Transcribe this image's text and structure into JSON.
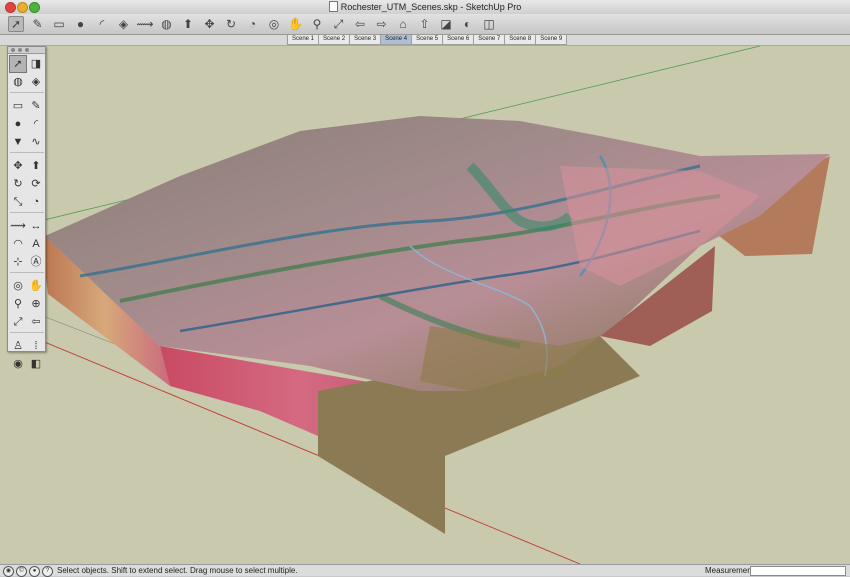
{
  "window": {
    "title": "Rochester_UTM_Scenes.skp - SketchUp Pro"
  },
  "toolbar": {
    "tools": [
      {
        "name": "select-tool-icon",
        "glyph": "➚",
        "selected": true
      },
      {
        "name": "pencil-tool-icon",
        "glyph": "✎"
      },
      {
        "name": "rectangle-tool-icon",
        "glyph": "▭"
      },
      {
        "name": "circle-tool-icon",
        "glyph": "●"
      },
      {
        "name": "arc-tool-icon",
        "glyph": "◜"
      },
      {
        "name": "eraser-tool-icon",
        "glyph": "◈"
      },
      {
        "name": "tape-measure-icon",
        "glyph": "⟿"
      },
      {
        "name": "paint-bucket-icon",
        "glyph": "◍"
      },
      {
        "name": "push-pull-icon",
        "glyph": "⬆"
      },
      {
        "name": "move-tool-icon",
        "glyph": "✥"
      },
      {
        "name": "rotate-tool-icon",
        "glyph": "↻"
      },
      {
        "name": "offset-tool-icon",
        "glyph": "◔"
      },
      {
        "name": "orbit-tool-icon",
        "glyph": "◎"
      },
      {
        "name": "pan-tool-icon",
        "glyph": "✋"
      },
      {
        "name": "zoom-tool-icon",
        "glyph": "⚲"
      },
      {
        "name": "zoom-extents-icon",
        "glyph": "⤢"
      },
      {
        "name": "previous-view-icon",
        "glyph": "⇦"
      },
      {
        "name": "next-view-icon",
        "glyph": "⇨"
      },
      {
        "name": "get-models-icon",
        "glyph": "⌂"
      },
      {
        "name": "share-model-icon",
        "glyph": "⇧"
      },
      {
        "name": "components-icon",
        "glyph": "◪"
      },
      {
        "name": "google-earth-icon",
        "glyph": "◐"
      },
      {
        "name": "extension-warehouse-icon",
        "glyph": "◫"
      }
    ]
  },
  "scenes": {
    "tabs": [
      "Scene 1",
      "Scene 2",
      "Scene 3",
      "Scene 4",
      "Scene 5",
      "Scene 6",
      "Scene 7",
      "Scene 8",
      "Scene 9"
    ],
    "active": "Scene 4"
  },
  "palette": {
    "tools": [
      {
        "name": "select-icon",
        "glyph": "➚",
        "selected": true
      },
      {
        "name": "make-component-icon",
        "glyph": "◨"
      },
      {
        "name": "paint-bucket-icon",
        "glyph": "◍"
      },
      {
        "name": "eraser-icon",
        "glyph": "◈"
      },
      {
        "name": "rectangle-icon",
        "glyph": "▭"
      },
      {
        "name": "line-icon",
        "glyph": "✎"
      },
      {
        "name": "circle-icon",
        "glyph": "●"
      },
      {
        "name": "arc-icon",
        "glyph": "◜"
      },
      {
        "name": "polygon-icon",
        "glyph": "▼"
      },
      {
        "name": "freehand-icon",
        "glyph": "∿"
      },
      {
        "name": "move-icon",
        "glyph": "✥"
      },
      {
        "name": "push-pull-icon",
        "glyph": "⬆"
      },
      {
        "name": "rotate-icon",
        "glyph": "↻"
      },
      {
        "name": "follow-me-icon",
        "glyph": "⟳"
      },
      {
        "name": "scale-icon",
        "glyph": "⤡"
      },
      {
        "name": "offset-icon",
        "glyph": "◔"
      },
      {
        "name": "tape-measure-icon",
        "glyph": "⟿"
      },
      {
        "name": "dimension-icon",
        "glyph": "↔"
      },
      {
        "name": "protractor-icon",
        "glyph": "◠"
      },
      {
        "name": "text-icon",
        "glyph": "A"
      },
      {
        "name": "axes-icon",
        "glyph": "⊹"
      },
      {
        "name": "3d-text-icon",
        "glyph": "Ⓐ"
      },
      {
        "name": "orbit-icon",
        "glyph": "◎"
      },
      {
        "name": "pan-icon",
        "glyph": "✋"
      },
      {
        "name": "zoom-icon",
        "glyph": "⚲"
      },
      {
        "name": "zoom-window-icon",
        "glyph": "⊕"
      },
      {
        "name": "zoom-extents-icon",
        "glyph": "⤢"
      },
      {
        "name": "previous-icon",
        "glyph": "⇦"
      },
      {
        "name": "position-camera-icon",
        "glyph": "♙"
      },
      {
        "name": "walk-icon",
        "glyph": "⁞"
      },
      {
        "name": "look-around-icon",
        "glyph": "◉"
      },
      {
        "name": "section-plane-icon",
        "glyph": "◧"
      }
    ]
  },
  "status": {
    "message": "Select objects. Shift to extend select. Drag mouse to select multiple.",
    "measurements_label": "Measurements",
    "measurements_value": ""
  },
  "colors": {
    "viewport_background": "#c9c9ad",
    "active_scene_tab": "#aebed4",
    "red_axis": "#c0392b",
    "green_axis": "#2e8b3a"
  }
}
